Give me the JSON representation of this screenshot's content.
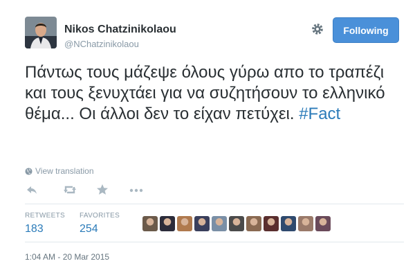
{
  "user": {
    "display_name": "Nikos Chatzinikolaou",
    "handle": "@NChatzinikolaou",
    "avatar_icon": "user-avatar-photo"
  },
  "header": {
    "follow_label": "Following",
    "follow_color": "#4a90d9",
    "gear_icon": "gear-icon"
  },
  "tweet": {
    "text": "Πάντως τους μάζεψε όλους γύρω απο το τραπέζι και τους ξενυχτάει για να συζητήσουν το ελληνικό θέμα... Οι άλλοι δεν το είχαν πετύχει.",
    "hashtag": "#Fact",
    "hashtag_color": "#2b7bb9"
  },
  "translation": {
    "label": "View translation",
    "icon": "globe-icon"
  },
  "actions": [
    {
      "name": "reply",
      "icon": "reply-icon"
    },
    {
      "name": "retweet",
      "icon": "retweet-icon"
    },
    {
      "name": "favorite",
      "icon": "star-icon"
    },
    {
      "name": "more",
      "icon": "more-icon"
    }
  ],
  "stats": {
    "retweets": {
      "label": "RETWEETS",
      "count": "183"
    },
    "favorites": {
      "label": "FAVORITES",
      "count": "254"
    }
  },
  "favoriters": [
    {
      "color": "#6b5a4a"
    },
    {
      "color": "#2c2c3a"
    },
    {
      "color": "#b07a4e"
    },
    {
      "color": "#3a3f5c"
    },
    {
      "color": "#7a8fa6"
    },
    {
      "color": "#4b4b4b"
    },
    {
      "color": "#8a6a52"
    },
    {
      "color": "#5a2e2e"
    },
    {
      "color": "#2f4a6e"
    },
    {
      "color": "#9a7a6a"
    },
    {
      "color": "#6a4a5a"
    }
  ],
  "timestamp": "1:04 AM - 20 Mar 2015"
}
